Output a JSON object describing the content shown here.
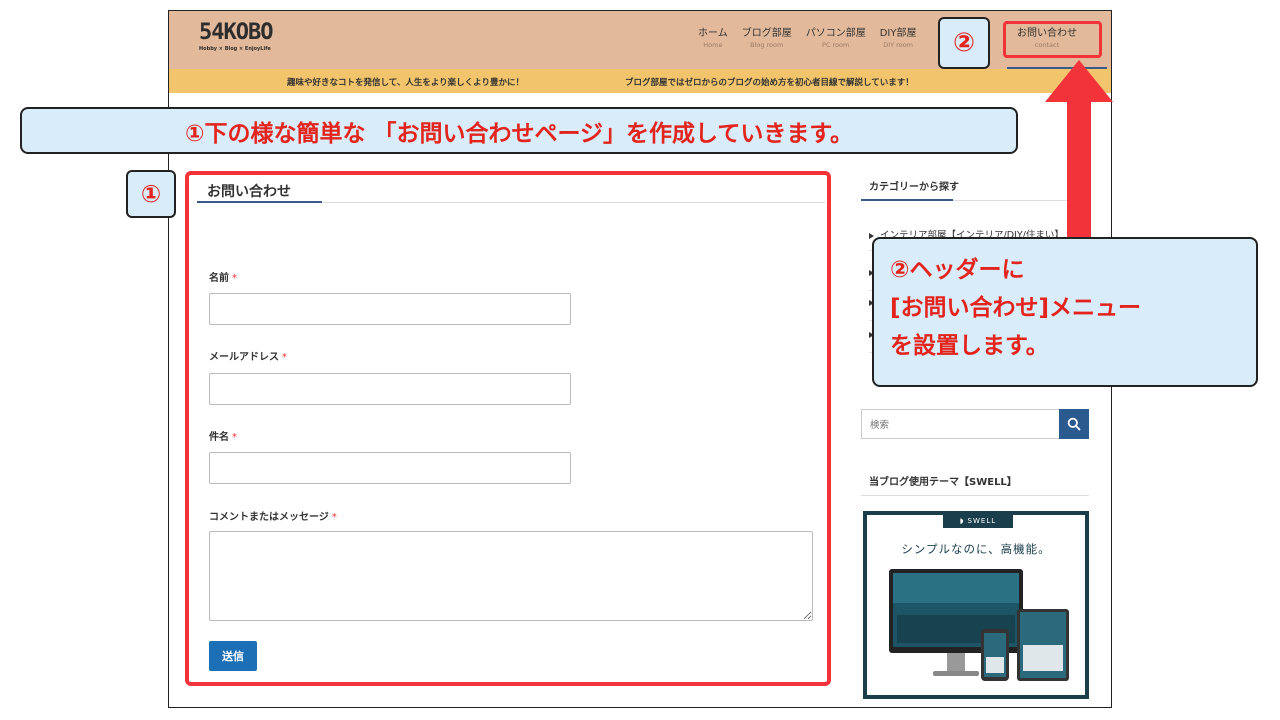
{
  "header": {
    "logo_text": "54KOBO",
    "logo_sub": "Hobby × Blog × EnjoyLife",
    "nav": [
      {
        "label": "ホーム",
        "sub": "Home"
      },
      {
        "label": "ブログ部屋",
        "sub": "Blog room"
      },
      {
        "label": "パソコン部屋",
        "sub": "PC room"
      },
      {
        "label": "DIY部屋",
        "sub": "DIY room"
      },
      {
        "label": "お問い合わせ",
        "sub": "contact"
      }
    ],
    "nav_partial": "屋"
  },
  "info_bar": {
    "left": "趣味や好きなコトを発信して、人生をより楽しくより豊かに！",
    "right": "ブログ部屋ではゼロからのブログの始め方を初心者目線で解説しています！"
  },
  "main": {
    "title": "お問い合わせ",
    "fields": [
      {
        "label": "名前",
        "required": "*"
      },
      {
        "label": "メールアドレス",
        "required": "*"
      },
      {
        "label": "件名",
        "required": "*"
      },
      {
        "label": "コメントまたはメッセージ",
        "required": "*"
      }
    ],
    "submit_label": "送信"
  },
  "sidebar": {
    "category_title": "カテゴリーから探す",
    "categories": [
      "インテリア部屋【インテリア/DIY/住まい】"
    ],
    "search_placeholder": "検索",
    "theme_title": "当ブログ使用テーマ【SWELL】",
    "banner_tag": "SWELL",
    "banner_text": "シンプルなのに、高機能。"
  },
  "annotations": {
    "badge_1": "①",
    "badge_2": "②",
    "callout_top": "①下の様な簡単な 「お問い合わせページ」を作成していきます。",
    "callout_right": [
      "②ヘッダーに",
      "[お問い合わせ]メニュー",
      "を設置します。"
    ]
  },
  "colors": {
    "header_bg": "#e2b99a",
    "info_bar_bg": "#f2c46b",
    "accent_blue": "#1d6fb5",
    "annotation_red": "#f2333a",
    "callout_bg": "#d8ecfa"
  }
}
